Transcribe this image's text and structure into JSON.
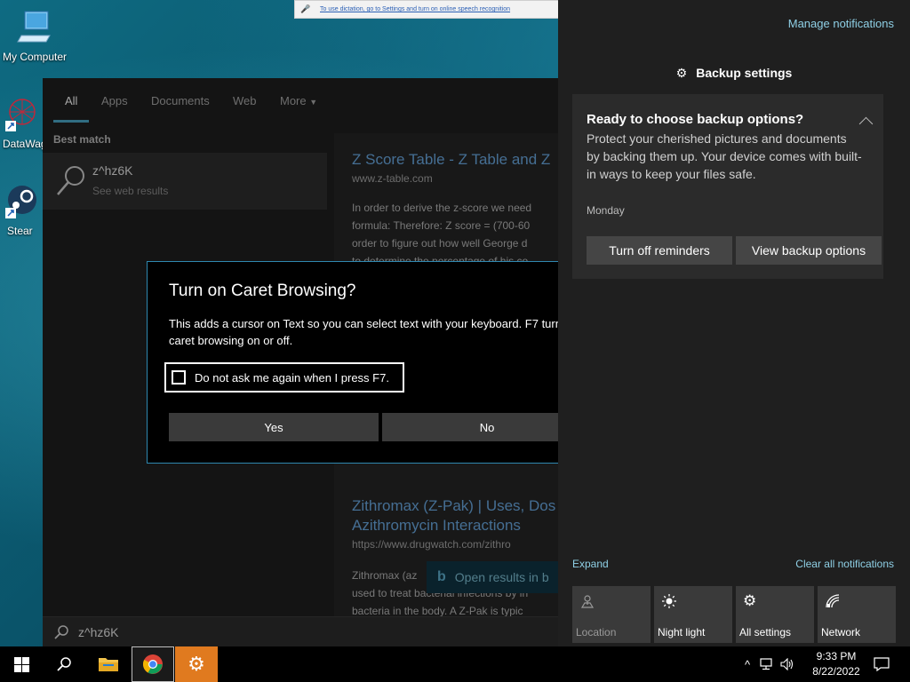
{
  "desktop": {
    "icons": [
      {
        "label": "My Computer"
      },
      {
        "label": "DataWag"
      },
      {
        "label": "Stear"
      }
    ]
  },
  "dictation": {
    "text": "To use dictation, go to Settings and turn on online speech recognition"
  },
  "search": {
    "tabs": [
      "All",
      "Apps",
      "Documents",
      "Web",
      "More"
    ],
    "best_match_label": "Best match",
    "best_item_title": "z^hz6K",
    "best_item_sub": "See web results",
    "query": "z^hz6K",
    "open_results": "Open results in b",
    "results": [
      {
        "title": "Z Score Table - Z Table and Z",
        "url": "www.z-table.com",
        "snippet": [
          "In order to derive the z-score we need",
          "formula: Therefore: Z score = (700-60",
          "order to figure out how well George d",
          "to determine the percentage of his co"
        ]
      },
      {
        "title": "Zithromax (Z-Pak) | Uses, Dos",
        "title2": "Azithromycin Interactions",
        "url": "https://www.drugwatch.com/zithro",
        "snippet": [
          "Zithromax (az",
          "used to treat bacterial infections by in",
          "bacteria in the body. A Z-Pak is typic"
        ]
      }
    ]
  },
  "caret_dialog": {
    "title": "Turn on Caret Browsing?",
    "body": "This adds a cursor on Text so you can select text with your keyboard. F7 turns caret browsing on or off.",
    "checkbox_label": "Do not ask me again when I press F7.",
    "yes": "Yes",
    "no": "No"
  },
  "action_center": {
    "manage": "Manage notifications",
    "app_name": "Backup settings",
    "notification": {
      "heading": "Ready to choose backup options?",
      "body": "Protect your cherished pictures and documents by backing them up. Your device comes with built-in ways to keep your files safe.",
      "date": "Monday",
      "btn_off": "Turn off reminders",
      "btn_view": "View backup options"
    },
    "expand": "Expand",
    "clear": "Clear all notifications",
    "quick_actions": [
      {
        "label": "Location",
        "icon": "location-icon"
      },
      {
        "label": "Night light",
        "icon": "brightness-icon"
      },
      {
        "label": "All settings",
        "icon": "gear-icon"
      },
      {
        "label": "Network",
        "icon": "network-icon"
      }
    ]
  },
  "taskbar": {
    "time": "9:33 PM",
    "date": "8/22/2022"
  }
}
